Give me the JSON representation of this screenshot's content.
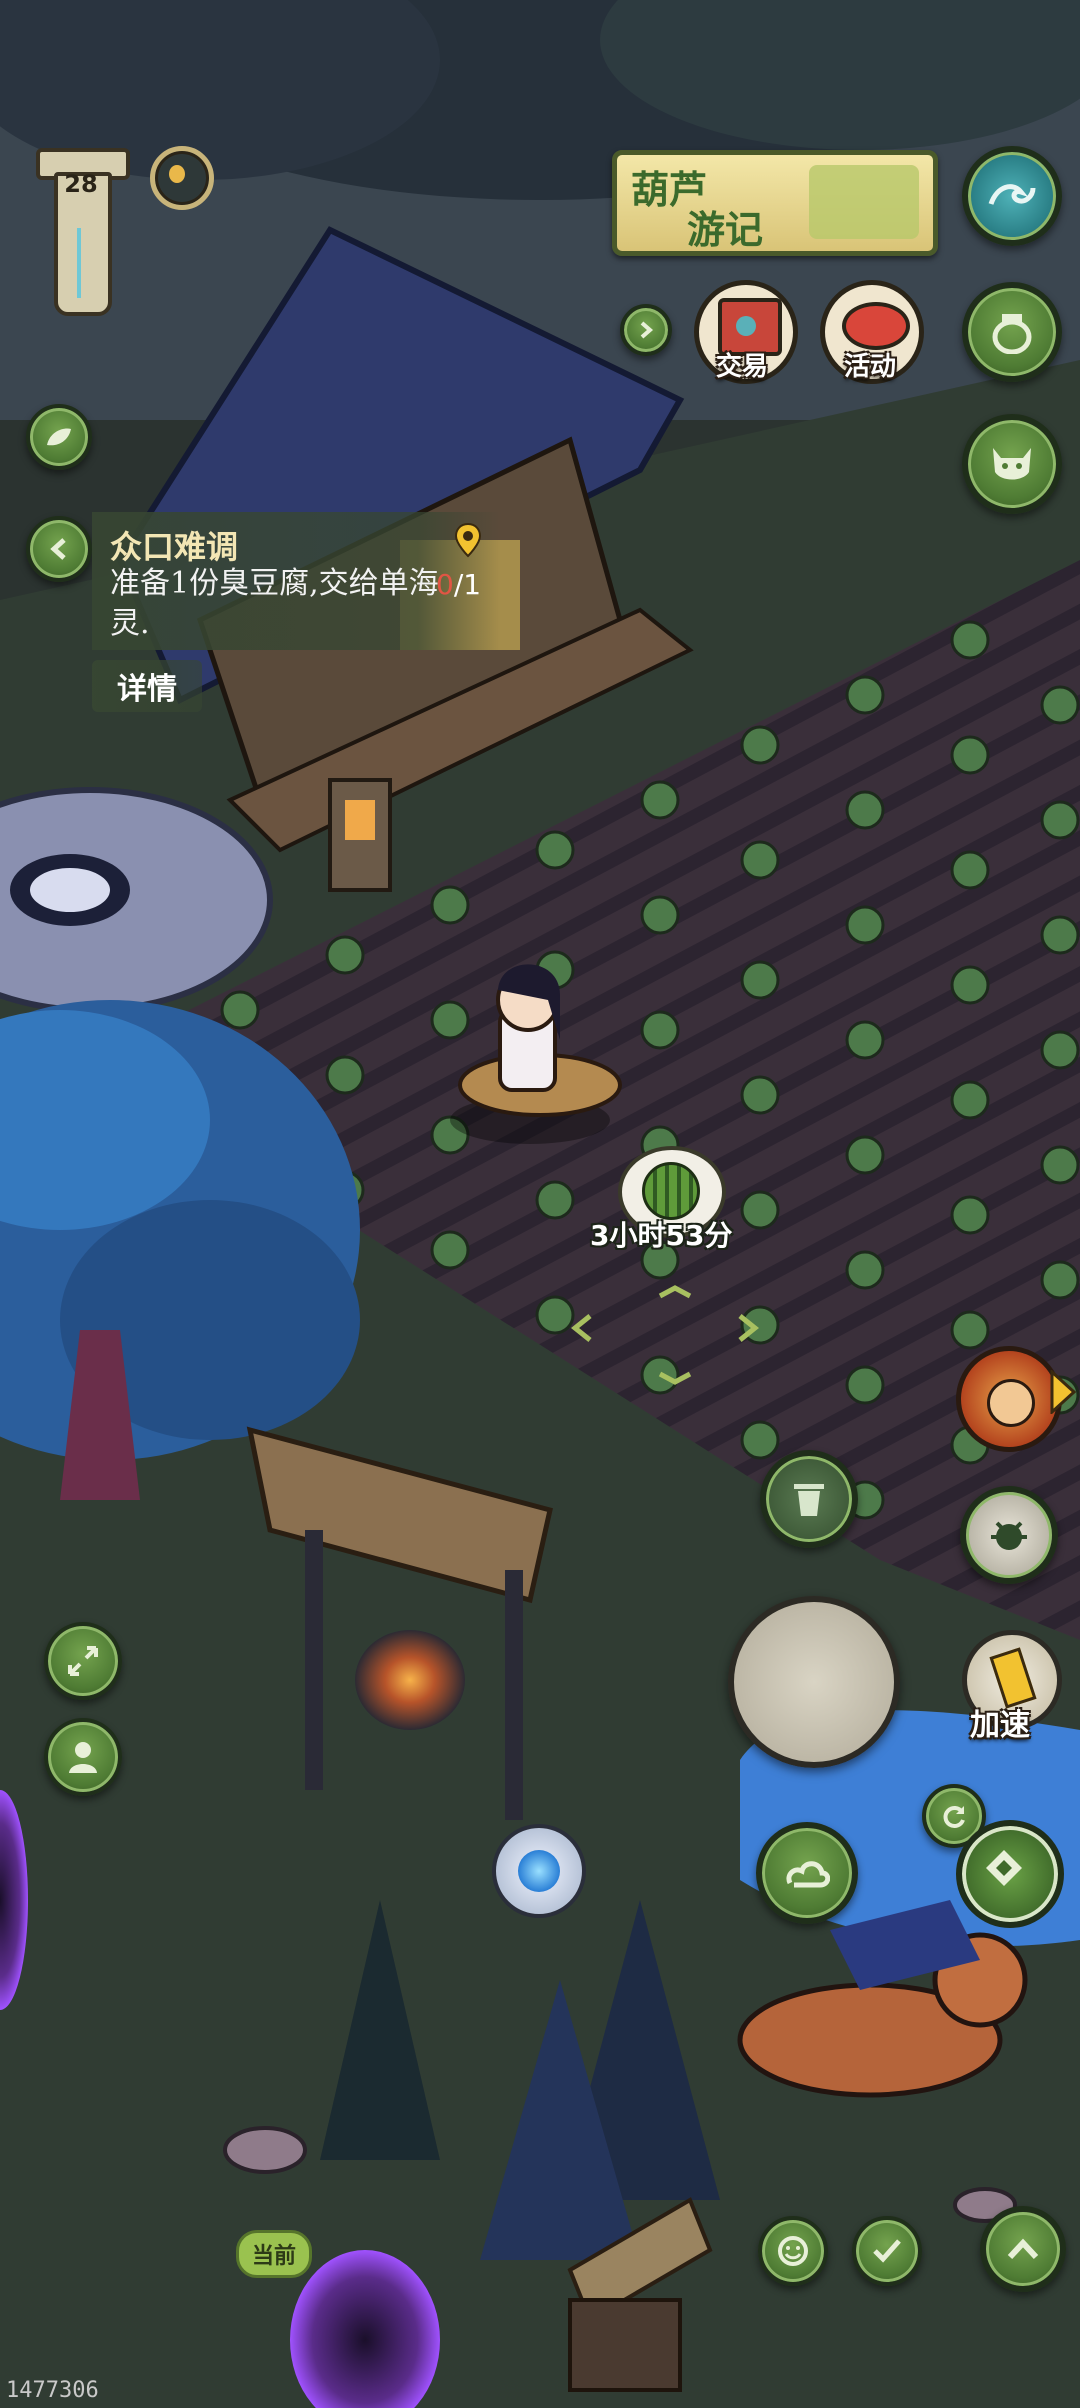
{
  "hud": {
    "level": "28"
  },
  "banner": {
    "title_line1": "葫芦",
    "title_line2": "游记"
  },
  "top_actions": {
    "trade_label": "交易",
    "activity_label": "活动"
  },
  "quest": {
    "title": "众口难调",
    "description": "准备1份臭豆腐,交给单海灵.",
    "progress_current": "0",
    "progress_total": "/1",
    "details_label": "详情"
  },
  "crop": {
    "timer": "3小时53分"
  },
  "actions": {
    "speedup_label": "加速",
    "current_label": "当前"
  },
  "footer": {
    "build_id": "1477306"
  },
  "colors": {
    "accent_green": "#4f7c34",
    "quest_progress_red": "#e25544",
    "banner_gold": "#e9d27a"
  }
}
